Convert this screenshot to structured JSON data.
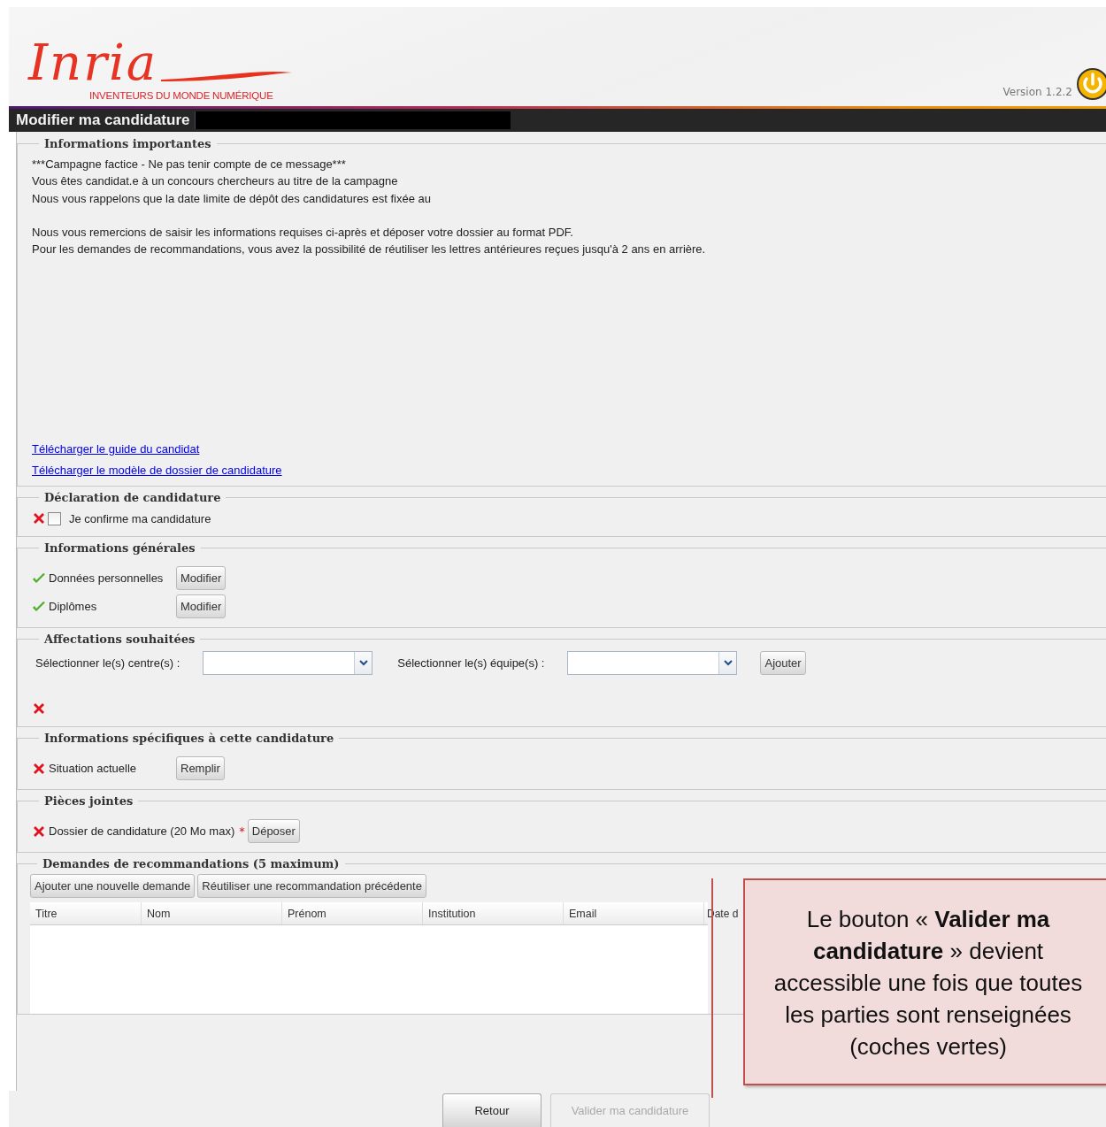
{
  "header": {
    "logo": "Inria",
    "tagline": "INVENTEURS DU MONDE NUMÉRIQUE",
    "version": "Version 1.2.2"
  },
  "title_bar": {
    "title": "Modifier ma candidature",
    "redacted": true
  },
  "sections": [
    {
      "kind": "info",
      "legend": "Informations importantes",
      "paragraphs": [
        [
          "***Campagne factice - Ne pas tenir compte de ce message***",
          "Vous êtes candidat.e à un concours chercheurs au titre de la campagne",
          "Nous vous rappelons que la date limite de dépôt des candidatures est fixée au"
        ],
        [
          "Nous vous remercions de saisir les informations requises ci-après et déposer votre dossier au format PDF.",
          "Pour les demandes de recommandations, vous avez la possibilité de réutiliser les lettres antérieures reçues jusqu'à 2 ans en arrière."
        ]
      ],
      "links": [
        "Télécharger le guide du candidat",
        "Télécharger le modèle de dossier de candidature"
      ]
    },
    {
      "kind": "declaration",
      "legend": "Déclaration de candidature",
      "complete": false,
      "checkbox": {
        "label": "Je confirme ma candidature",
        "checked": false
      }
    },
    {
      "kind": "items",
      "legend": "Informations générales",
      "items": [
        {
          "label": "Données personnelles",
          "complete": true,
          "button": "Modifier"
        },
        {
          "label": "Diplômes",
          "complete": true,
          "button": "Modifier"
        }
      ]
    },
    {
      "kind": "affectations",
      "legend": "Affectations souhaitées",
      "selects": [
        {
          "label": "Sélectionner le(s) centre(s) :"
        },
        {
          "label": "Sélectionner le(s) équipe(s) :"
        }
      ],
      "button": "Ajouter",
      "complete": false
    },
    {
      "kind": "items",
      "legend": "Informations spécifiques à cette candidature",
      "items": [
        {
          "label": "Situation actuelle",
          "complete": false,
          "button": "Remplir"
        }
      ]
    },
    {
      "kind": "items",
      "legend": "Pièces jointes",
      "items": [
        {
          "label": "Dossier de candidature (20 Mo max)",
          "complete": false,
          "required_mark": "*",
          "button": "Déposer"
        }
      ]
    },
    {
      "kind": "recommendations",
      "legend": "Demandes de recommandations (5 maximum)",
      "buttons": [
        "Ajouter une nouvelle demande",
        "Réutiliser une recommandation précédente"
      ],
      "columns": [
        "Titre",
        "Nom",
        "Prénom",
        "Institution",
        "Email",
        "Date d"
      ]
    }
  ],
  "footer": {
    "buttons": [
      {
        "label": "Retour",
        "disabled": false
      },
      {
        "label": "Valider ma candidature",
        "disabled": true
      }
    ]
  },
  "callout": {
    "text": "Le bouton « **Valider ma candidature** » devient accessible une fois que toutes les parties sont renseignées (coches vertes)"
  }
}
